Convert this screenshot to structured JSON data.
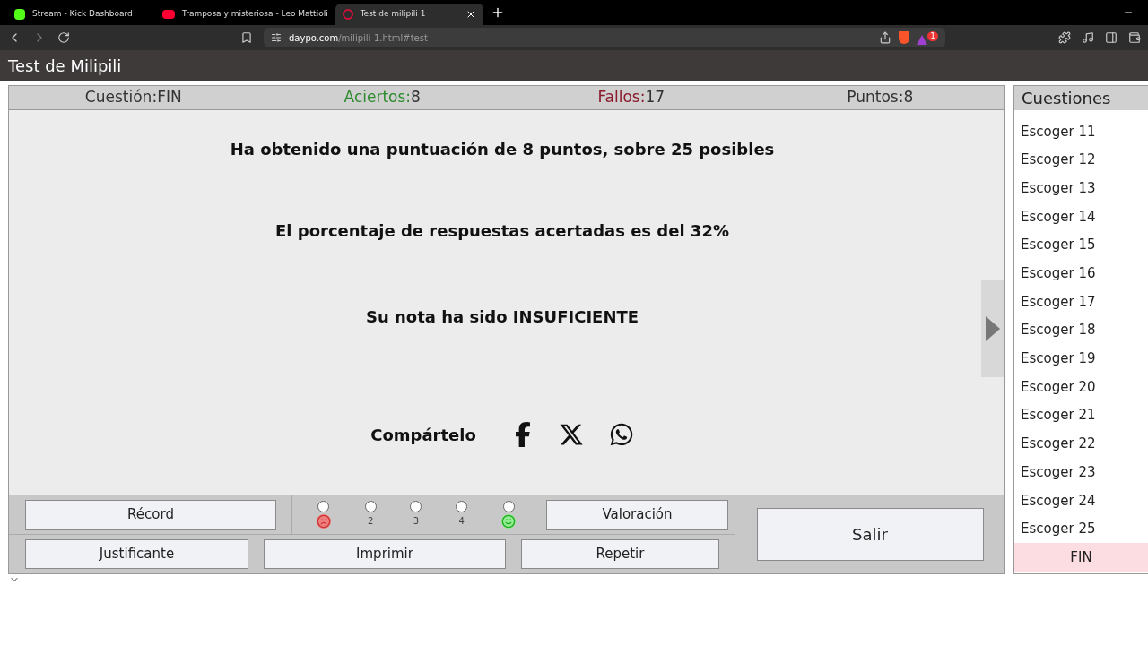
{
  "browser": {
    "tabs": [
      {
        "title": "Stream - Kick Dashboard",
        "kind": "kick",
        "selected": false
      },
      {
        "title": "Tramposa y misteriosa - Leo Mattioli",
        "kind": "youtube",
        "selected": false
      },
      {
        "title": "Test de milipili 1",
        "kind": "daypo",
        "selected": true
      }
    ],
    "url": {
      "host": "daypo.com",
      "path": "/milipili-1.html#test"
    },
    "badge": "1"
  },
  "page_title": "Test de Milipili",
  "stats": [
    {
      "label": "Cuestión:",
      "value": "FIN",
      "color": "#333333"
    },
    {
      "label": "Aciertos:",
      "value": "8",
      "color": "#2e8b2e"
    },
    {
      "label": "Fallos:",
      "value": "17",
      "color": "#8b1a2b"
    },
    {
      "label": "Puntos:",
      "value": "8",
      "color": "#333333"
    }
  ],
  "result": {
    "lines": [
      "Ha obtenido una puntuación de 8 puntos, sobre 25 posibles",
      "El porcentaje de respuestas acertadas es del 32%",
      "Su nota ha sido INSUFICIENTE"
    ],
    "share_label": "Compártelo"
  },
  "controls": {
    "record": "Récord",
    "rating": [
      {
        "kind": "sad",
        "checked": false
      },
      {
        "kind": "number",
        "label": "2",
        "checked": false
      },
      {
        "kind": "number",
        "label": "3",
        "checked": false
      },
      {
        "kind": "number",
        "label": "4",
        "checked": false
      },
      {
        "kind": "happy",
        "checked": false
      }
    ],
    "valoracion": "Valoración",
    "justificante": "Justificante",
    "imprimir": "Imprimir",
    "repetir": "Repetir",
    "salir": "Salir"
  },
  "sidebar": {
    "title": "Cuestiones",
    "items": [
      {
        "label": "Escoger 11",
        "selected": false
      },
      {
        "label": "Escoger 12",
        "selected": false
      },
      {
        "label": "Escoger 13",
        "selected": false
      },
      {
        "label": "Escoger 14",
        "selected": false
      },
      {
        "label": "Escoger 15",
        "selected": false
      },
      {
        "label": "Escoger 16",
        "selected": false
      },
      {
        "label": "Escoger 17",
        "selected": false
      },
      {
        "label": "Escoger 18",
        "selected": false
      },
      {
        "label": "Escoger 19",
        "selected": false
      },
      {
        "label": "Escoger 20",
        "selected": false
      },
      {
        "label": "Escoger 21",
        "selected": false
      },
      {
        "label": "Escoger 22",
        "selected": false
      },
      {
        "label": "Escoger 23",
        "selected": false
      },
      {
        "label": "Escoger 24",
        "selected": false
      },
      {
        "label": "Escoger 25",
        "selected": false
      },
      {
        "label": "FIN",
        "selected": true
      }
    ]
  }
}
